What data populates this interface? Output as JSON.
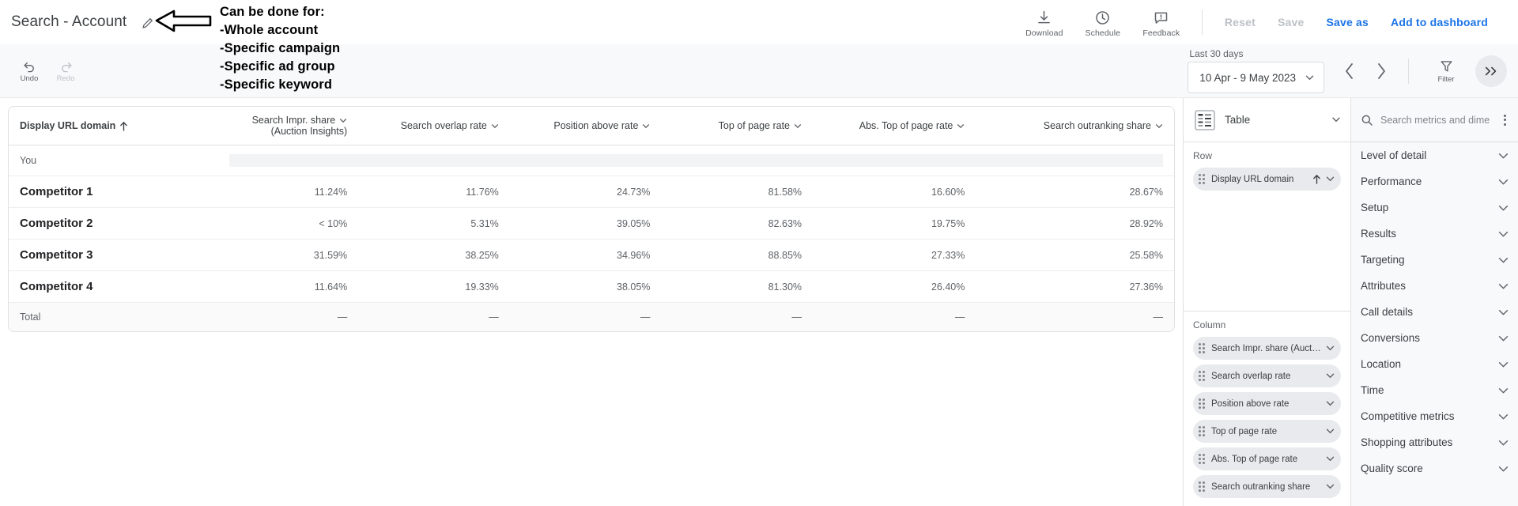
{
  "header": {
    "report_title": "Search - Account",
    "edit_icon": "pencil-icon",
    "actions": [
      {
        "label": "Download",
        "icon": "download-icon"
      },
      {
        "label": "Schedule",
        "icon": "clock-icon"
      },
      {
        "label": "Feedback",
        "icon": "feedback-icon"
      }
    ],
    "buttons": [
      {
        "label": "Reset",
        "state": "disabled"
      },
      {
        "label": "Save",
        "state": "disabled"
      },
      {
        "label": "Save as",
        "state": "primary"
      },
      {
        "label": "Add to dashboard",
        "state": "primary"
      }
    ]
  },
  "annotation": {
    "arrow": "left-arrow-annotation",
    "line1": "Can be done for:",
    "line2": "-Whole account",
    "line3": "-Specific campaign",
    "line4": "-Specific ad group",
    "line5": "-Specific keyword"
  },
  "toolbar": {
    "undo_label": "Undo",
    "redo_label": "Redo",
    "date_preset_label": "Last 30 days",
    "date_range_value": "10 Apr - 9 May 2023",
    "prev_icon": "chevron-left-icon",
    "next_icon": "chevron-right-icon",
    "filter_label": "Filter",
    "expand_icon": "double-chevron-right-icon"
  },
  "table": {
    "columns": [
      {
        "label": "Display URL domain",
        "sort": "ascending",
        "menu": false
      },
      {
        "label": "Search Impr. share",
        "label2": "(Auction Insights)",
        "menu": true
      },
      {
        "label": "Search overlap rate",
        "menu": true
      },
      {
        "label": "Position above rate",
        "menu": true
      },
      {
        "label": "Top of page rate",
        "menu": true
      },
      {
        "label": "Abs. Top of page rate",
        "menu": true
      },
      {
        "label": "Search outranking share",
        "menu": true
      }
    ],
    "rows": [
      {
        "type": "you",
        "name": "You",
        "values": [
          "",
          "",
          "",
          "",
          "",
          ""
        ]
      },
      {
        "type": "competitor",
        "name": "Competitor 1",
        "values": [
          "11.24%",
          "11.76%",
          "24.73%",
          "81.58%",
          "16.60%",
          "28.67%"
        ]
      },
      {
        "type": "competitor",
        "name": "Competitor 2",
        "values": [
          "< 10%",
          "5.31%",
          "39.05%",
          "82.63%",
          "19.75%",
          "28.92%"
        ]
      },
      {
        "type": "competitor",
        "name": "Competitor 3",
        "values": [
          "31.59%",
          "38.25%",
          "34.96%",
          "88.85%",
          "27.33%",
          "25.58%"
        ]
      },
      {
        "type": "competitor",
        "name": "Competitor 4",
        "values": [
          "11.64%",
          "19.33%",
          "38.05%",
          "81.30%",
          "26.40%",
          "27.36%"
        ]
      },
      {
        "type": "total",
        "name": "Total",
        "values": [
          "—",
          "—",
          "—",
          "—",
          "—",
          "—"
        ]
      }
    ]
  },
  "config": {
    "viz_type": "Table",
    "viz_icon": "table-icon",
    "row_section_label": "Row",
    "row_chips": [
      {
        "label": "Display URL domain",
        "sort_icon": "arrow-up-icon",
        "menu_icon": "chevron-down-icon"
      }
    ],
    "column_section_label": "Column",
    "column_chips": [
      {
        "label": "Search Impr. share (Auction Insight…"
      },
      {
        "label": "Search overlap rate"
      },
      {
        "label": "Position above rate"
      },
      {
        "label": "Top of page rate"
      },
      {
        "label": "Abs. Top of page rate"
      },
      {
        "label": "Search outranking share"
      }
    ]
  },
  "metrics": {
    "search_placeholder": "Search metrics and dime...",
    "search_value": "",
    "search_icon": "search-icon",
    "overflow_icon": "kebab-menu-icon",
    "categories": [
      {
        "label": "Level of detail"
      },
      {
        "label": "Performance"
      },
      {
        "label": "Setup"
      },
      {
        "label": "Results"
      },
      {
        "label": "Targeting"
      },
      {
        "label": "Attributes"
      },
      {
        "label": "Call details"
      },
      {
        "label": "Conversions"
      },
      {
        "label": "Location"
      },
      {
        "label": "Time"
      },
      {
        "label": "Competitive metrics"
      },
      {
        "label": "Shopping attributes"
      },
      {
        "label": "Quality score"
      }
    ]
  },
  "colors": {
    "accent": "#1a73e8",
    "disabled": "#bdc1c6",
    "text": "#3c4043"
  }
}
